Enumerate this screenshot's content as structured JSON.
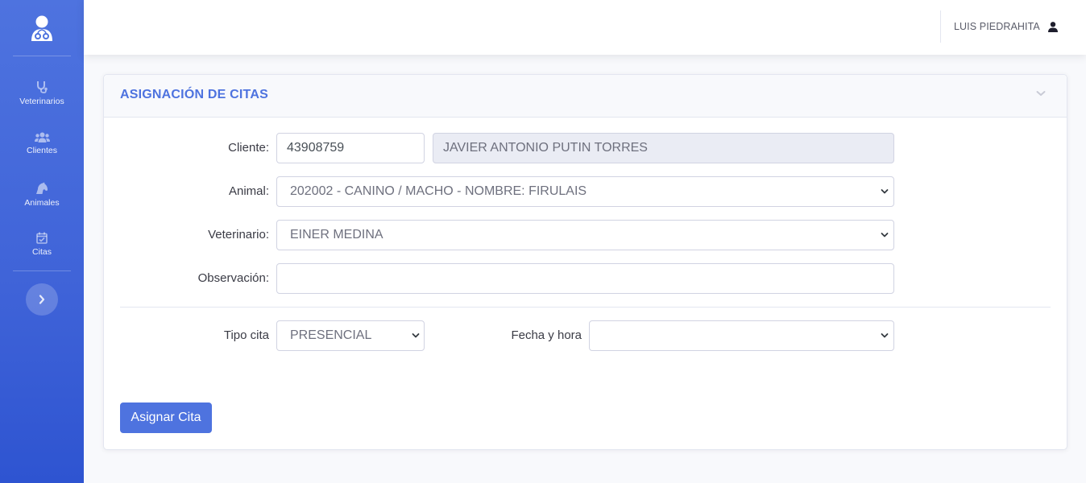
{
  "sidebar": {
    "items": [
      {
        "label": "Veterinarios",
        "icon": "stethoscope-icon"
      },
      {
        "label": "Clientes",
        "icon": "users-icon"
      },
      {
        "label": "Animales",
        "icon": "horse-head-icon"
      },
      {
        "label": "Citas",
        "icon": "calendar-check-icon"
      }
    ],
    "toggle_icon": "chevron-right-icon"
  },
  "topbar": {
    "user_name": "LUIS PIEDRAHITA",
    "user_icon": "user-icon"
  },
  "card": {
    "title": "ASIGNACIÓN DE CITAS",
    "collapse_icon": "chevron-down-icon"
  },
  "form": {
    "cliente_label": "Cliente:",
    "cliente_id": "43908759",
    "cliente_name": "JAVIER ANTONIO PUTIN TORRES",
    "animal_label": "Animal:",
    "animal_value": "202002 - CANINO / MACHO - NOMBRE: FIRULAIS",
    "veterinario_label": "Veterinario:",
    "veterinario_value": "EINER MEDINA",
    "observacion_label": "Observación:",
    "observacion_value": "",
    "tipo_cita_label": "Tipo cita",
    "tipo_cita_value": "PRESENCIAL",
    "fecha_hora_label": "Fecha y hora",
    "fecha_hora_value": "",
    "submit_label": "Asignar Cita"
  },
  "colors": {
    "primary": "#4e73df",
    "background": "#f8f9fc",
    "text": "#3a3b45"
  }
}
